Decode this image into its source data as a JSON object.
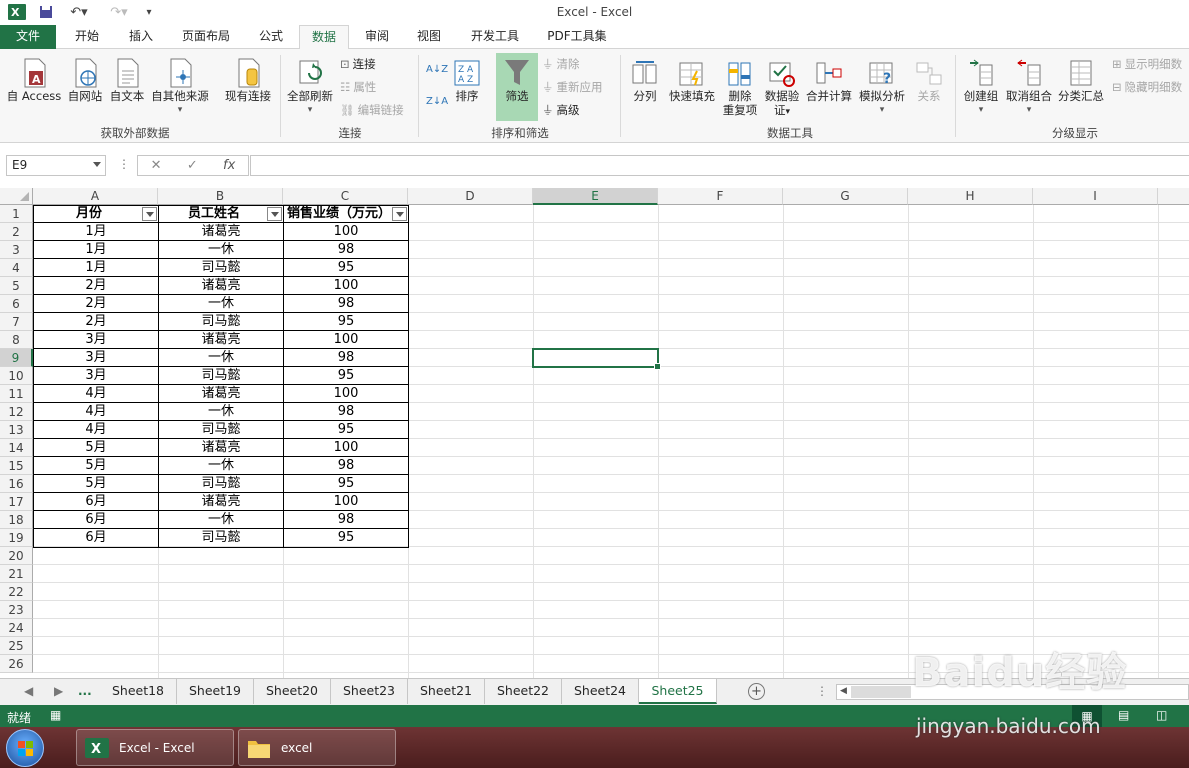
{
  "window": {
    "title": "Excel - Excel"
  },
  "tabs": [
    {
      "label": "文件"
    },
    {
      "label": "开始"
    },
    {
      "label": "插入"
    },
    {
      "label": "页面布局"
    },
    {
      "label": "公式"
    },
    {
      "label": "数据"
    },
    {
      "label": "审阅"
    },
    {
      "label": "视图"
    },
    {
      "label": "开发工具"
    },
    {
      "label": "PDF工具集"
    }
  ],
  "ribbon": {
    "get_external": {
      "label": "获取外部数据",
      "access": "自 Access",
      "web": "自网站",
      "text": "自文本",
      "other": "自其他来源"
    },
    "existing": "现有连接",
    "connections": {
      "label": "连接",
      "refresh_all": "全部刷新",
      "connect": "连接",
      "properties": "属性",
      "edit_links": "编辑链接"
    },
    "sort_filter": {
      "label": "排序和筛选",
      "sort": "排序",
      "filter": "筛选",
      "clear": "清除",
      "reapply": "重新应用",
      "advanced": "高级"
    },
    "data_tools": {
      "label": "数据工具",
      "split": "分列",
      "flash_fill": "快速填充",
      "remove_dup_1": "删除",
      "remove_dup_2": "重复项",
      "validation_1": "数据验",
      "validation_2": "证",
      "consolidate": "合并计算",
      "whatif": "模拟分析",
      "relationships": "关系"
    },
    "outline": {
      "label": "分级显示",
      "group": "创建组",
      "ungroup": "取消组合",
      "subtotal": "分类汇总",
      "show_detail": "显示明细数",
      "hide_detail": "隐藏明细数"
    }
  },
  "formula_bar": {
    "name_box": "E9",
    "value": ""
  },
  "columns": [
    "A",
    "B",
    "C",
    "D",
    "E",
    "F",
    "G",
    "H",
    "I"
  ],
  "rows": [
    "1",
    "2",
    "3",
    "4",
    "5",
    "6",
    "7",
    "8",
    "9",
    "10",
    "11",
    "12",
    "13",
    "14",
    "15",
    "16",
    "17",
    "18",
    "19",
    "20",
    "21",
    "22",
    "23",
    "24",
    "25",
    "26"
  ],
  "table": {
    "headers": [
      "月份",
      "员工姓名",
      "销售业绩（万元）"
    ],
    "rows": [
      [
        "1月",
        "诸葛亮",
        "100"
      ],
      [
        "1月",
        "一休",
        "98"
      ],
      [
        "1月",
        "司马懿",
        "95"
      ],
      [
        "2月",
        "诸葛亮",
        "100"
      ],
      [
        "2月",
        "一休",
        "98"
      ],
      [
        "2月",
        "司马懿",
        "95"
      ],
      [
        "3月",
        "诸葛亮",
        "100"
      ],
      [
        "3月",
        "一休",
        "98"
      ],
      [
        "3月",
        "司马懿",
        "95"
      ],
      [
        "4月",
        "诸葛亮",
        "100"
      ],
      [
        "4月",
        "一休",
        "98"
      ],
      [
        "4月",
        "司马懿",
        "95"
      ],
      [
        "5月",
        "诸葛亮",
        "100"
      ],
      [
        "5月",
        "一休",
        "98"
      ],
      [
        "5月",
        "司马懿",
        "95"
      ],
      [
        "6月",
        "诸葛亮",
        "100"
      ],
      [
        "6月",
        "一休",
        "98"
      ],
      [
        "6月",
        "司马懿",
        "95"
      ]
    ]
  },
  "sheets": {
    "ellipsis": "...",
    "tabs": [
      "Sheet18",
      "Sheet19",
      "Sheet20",
      "Sheet23",
      "Sheet21",
      "Sheet22",
      "Sheet24",
      "Sheet25"
    ],
    "active": "Sheet25"
  },
  "status": {
    "ready": "就绪"
  },
  "taskbar": {
    "excel": "Excel - Excel",
    "folder": "excel"
  },
  "watermark": {
    "brand": "Baidu经验",
    "url": "jingyan.baidu.com"
  },
  "colors": {
    "accent": "#217346",
    "taskbar": "#5a2626"
  }
}
